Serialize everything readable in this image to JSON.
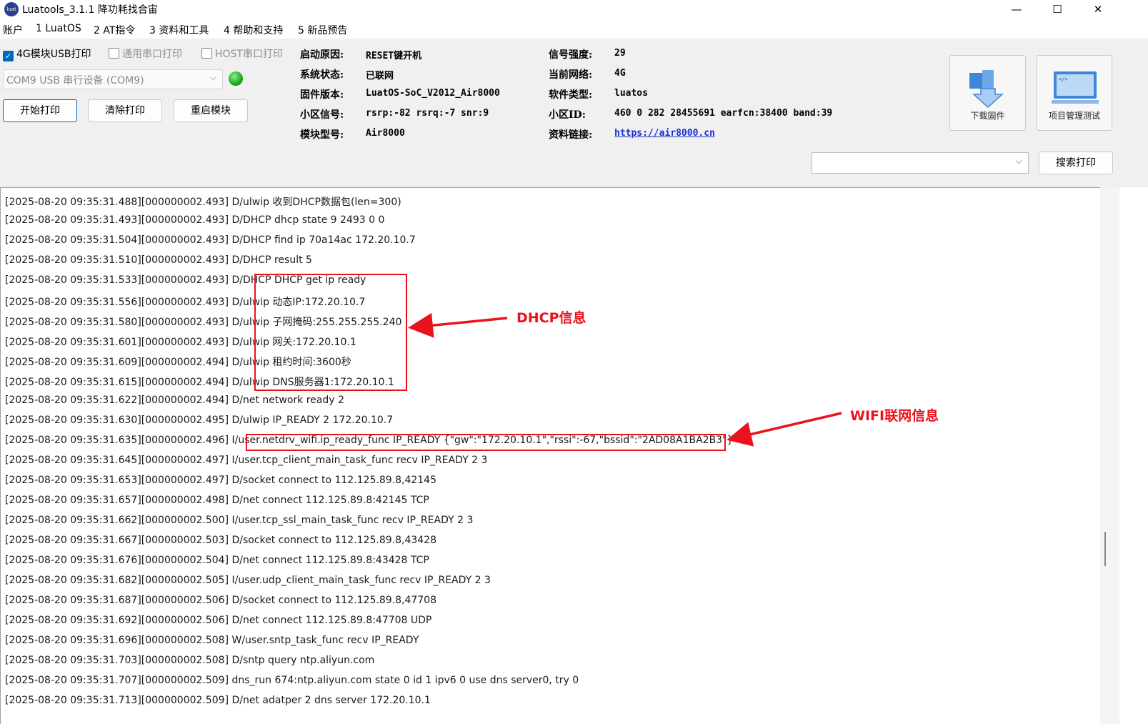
{
  "window": {
    "title": "Luatools_3.1.1 降功耗找合宙",
    "logo_text": "luat",
    "controls": [
      "—",
      "☐",
      "✕"
    ]
  },
  "menu": [
    "账户",
    "1 LuatOS",
    "2 AT指令",
    "3 资料和工具",
    "4 帮助和支持",
    "5 新品预告"
  ],
  "options": {
    "usb_print": "4G模块USB打印",
    "serial_print": "通用串口打印",
    "host_print": "HOST串口打印",
    "port": "COM9 USB 串行设备 (COM9)"
  },
  "buttons": {
    "start": "开始打印",
    "clear": "清除打印",
    "restart": "重启模块",
    "download": "下载固件",
    "project": "项目管理测试",
    "search": "搜索打印"
  },
  "info": {
    "boot_reason_label": "启动原因:",
    "boot_reason": "RESET键开机",
    "sys_state_label": "系统状态:",
    "sys_state": "已联网",
    "firmware_label": "固件版本:",
    "firmware": "LuatOS-SoC_V2012_Air8000",
    "cell_signal_label": "小区信号:",
    "cell_signal": "rsrp:-82 rsrq:-7 snr:9",
    "model_label": "模块型号:",
    "model": "Air8000",
    "signal_label": "信号强度:",
    "signal": "29",
    "network_label": "当前网络:",
    "network": "4G",
    "software_label": "软件类型:",
    "software": "luatos",
    "cell_id_label": "小区ID:",
    "cell_id": "460 0 282 28455691 earfcn:38400 band:39",
    "link_label": "资料链接:",
    "link": "https://air8000.cn"
  },
  "log": [
    "[2025-08-20 09:35:31.488][000000002.493] D/ulwip 收到DHCP数据包(len=300)",
    "[2025-08-20 09:35:31.493][000000002.493] D/DHCP dhcp state 9 2493 0 0",
    "[2025-08-20 09:35:31.504][000000002.493] D/DHCP find ip 70a14ac 172.20.10.7",
    "[2025-08-20 09:35:31.510][000000002.493] D/DHCP result 5",
    "[2025-08-20 09:35:31.533][000000002.493] D/DHCP DHCP get ip ready",
    "[2025-08-20 09:35:31.556][000000002.493] D/ulwip 动态IP:172.20.10.7",
    "[2025-08-20 09:35:31.580][000000002.493] D/ulwip 子网掩码:255.255.255.240",
    "[2025-08-20 09:35:31.601][000000002.493] D/ulwip 网关:172.20.10.1",
    "[2025-08-20 09:35:31.609][000000002.494] D/ulwip 租约时间:3600秒",
    "[2025-08-20 09:35:31.615][000000002.494] D/ulwip DNS服务器1:172.20.10.1",
    "[2025-08-20 09:35:31.622][000000002.494] D/net network ready 2",
    "[2025-08-20 09:35:31.630][000000002.495] D/ulwip IP_READY 2 172.20.10.7",
    "[2025-08-20 09:35:31.635][000000002.496] I/user.netdrv_wifi.ip_ready_func IP_READY {\"gw\":\"172.20.10.1\",\"rssi\":-67,\"bssid\":\"2AD08A1BA2B3\"}",
    "[2025-08-20 09:35:31.645][000000002.497] I/user.tcp_client_main_task_func recv IP_READY 2 3",
    "[2025-08-20 09:35:31.653][000000002.497] D/socket connect to 112.125.89.8,42145",
    "[2025-08-20 09:35:31.657][000000002.498] D/net connect 112.125.89.8:42145 TCP",
    "[2025-08-20 09:35:31.662][000000002.500] I/user.tcp_ssl_main_task_func recv IP_READY 2 3",
    "[2025-08-20 09:35:31.667][000000002.503] D/socket connect to 112.125.89.8,43428",
    "[2025-08-20 09:35:31.676][000000002.504] D/net connect 112.125.89.8:43428 TCP",
    "[2025-08-20 09:35:31.682][000000002.505] I/user.udp_client_main_task_func recv IP_READY 2 3",
    "[2025-08-20 09:35:31.687][000000002.506] D/socket connect to 112.125.89.8,47708",
    "[2025-08-20 09:35:31.692][000000002.506] D/net connect 112.125.89.8:47708 UDP",
    "[2025-08-20 09:35:31.696][000000002.508] W/user.sntp_task_func recv IP_READY",
    "[2025-08-20 09:35:31.703][000000002.508] D/sntp query ntp.aliyun.com",
    "[2025-08-20 09:35:31.707][000000002.509] dns_run 674:ntp.aliyun.com state 0 id 1 ipv6 0 use dns server0, try 0",
    "[2025-08-20 09:35:31.713][000000002.509] D/net adatper 2 dns server 172.20.10.1"
  ],
  "annotations": {
    "dhcp": "DHCP信息",
    "wifi": "WIFI联网信息",
    "color": "#e8131c"
  }
}
